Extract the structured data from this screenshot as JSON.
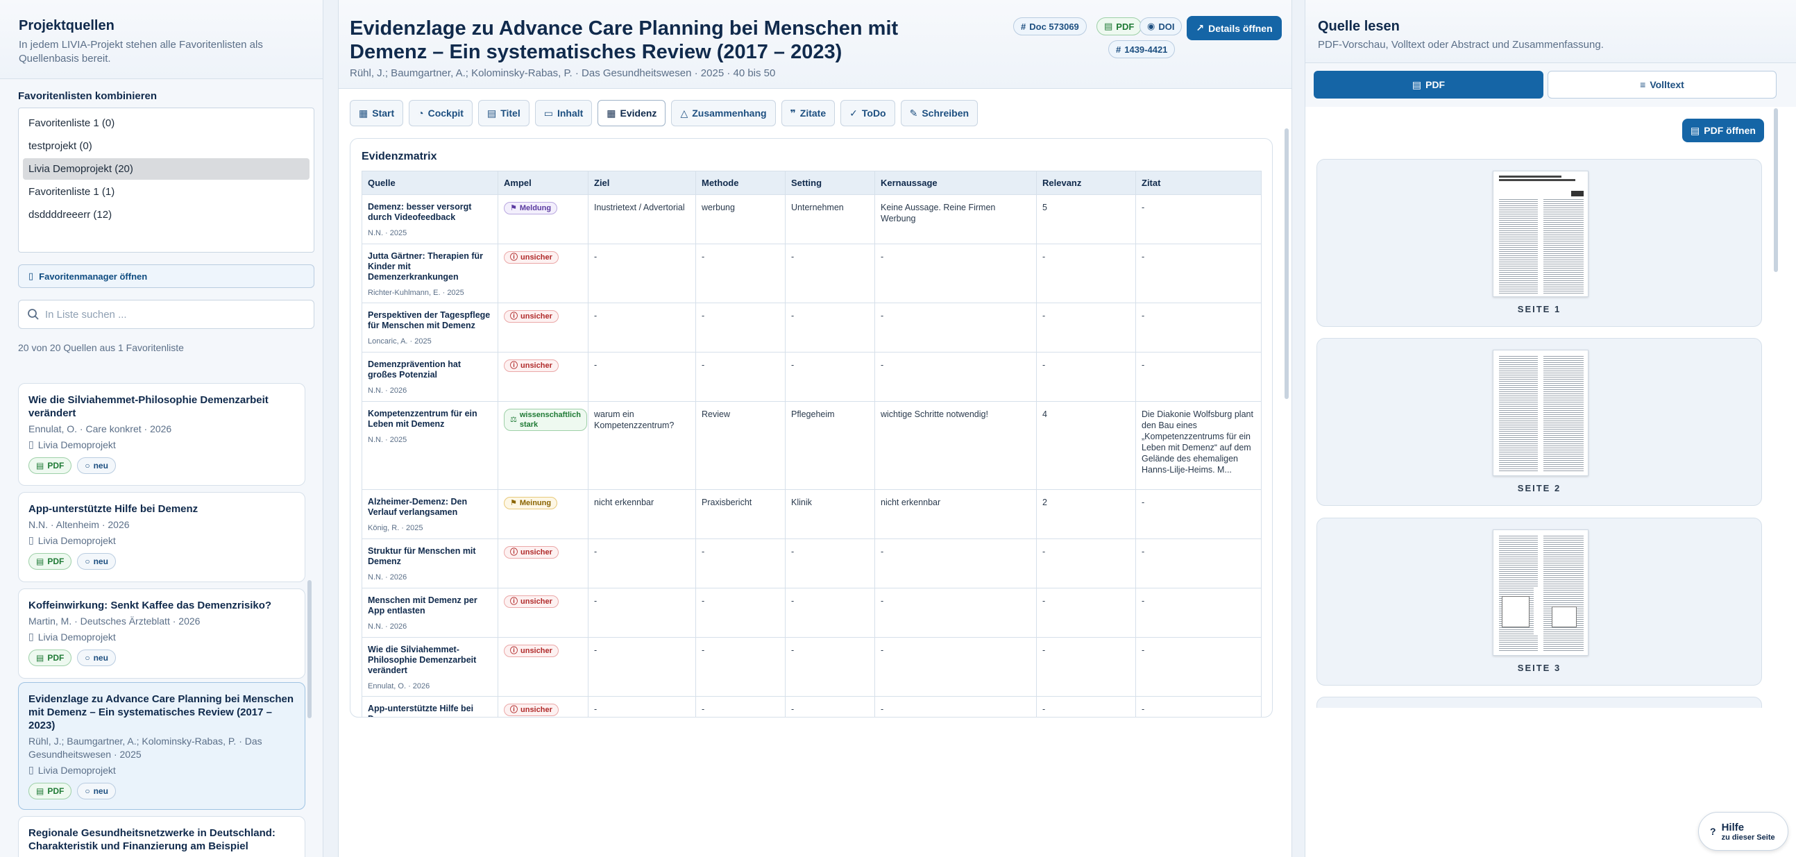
{
  "left": {
    "title": "Projektquellen",
    "subtitle": "In jedem LIVIA-Projekt stehen alle Favoritenlisten als Quellenbasis bereit.",
    "combine_label": "Favoritenlisten kombinieren",
    "lists": [
      "Favoritenliste 1 (0)",
      "testprojekt (0)",
      "Livia Demoprojekt (20)",
      "Favoritenliste 1 (1)",
      "dsddddreeerr (12)"
    ],
    "manager_button": "Favoritenmanager öffnen",
    "search_placeholder": "In Liste suchen ...",
    "count_text": "20 von 20 Quellen aus 1 Favoritenliste",
    "cards": [
      {
        "title": "Wie die Silviahemmet-Philosophie Demenzarbeit verändert",
        "meta": "Ennulat, O. · Care konkret · 2026",
        "project": "Livia Demoprojekt",
        "tag_pdf": "PDF",
        "tag_neu": "neu"
      },
      {
        "title": "App-unterstützte Hilfe bei Demenz",
        "meta": "N.N. · Altenheim · 2026",
        "project": "Livia Demoprojekt",
        "tag_pdf": "PDF",
        "tag_neu": "neu"
      },
      {
        "title": "Koffeinwirkung: Senkt Kaffee das Demenzrisiko?",
        "meta": "Martin, M. · Deutsches Ärzteblatt · 2026",
        "project": "Livia Demoprojekt",
        "tag_pdf": "PDF",
        "tag_neu": "neu"
      },
      {
        "title": "Evidenzlage zu Advance Care Planning bei Menschen mit Demenz – Ein systematisches Review (2017 – 2023)",
        "meta": "Rühl, J.; Baumgartner, A.; Kolominsky-Rabas, P. · Das Gesundheitswesen · 2025",
        "project": "Livia Demoprojekt",
        "tag_pdf": "PDF",
        "tag_neu": "neu"
      },
      {
        "title": "Regionale Gesundheitsnetzwerke in Deutschland: Charakteristik und Finanzierung am Beispiel"
      }
    ]
  },
  "main": {
    "title": "Evidenzlage zu Advance Care Planning bei Menschen mit Demenz – Ein systematisches Review (2017 – 2023)",
    "subline": "Rühl, J.; Baumgartner, A.; Kolominsky-Rabas, P. · Das Gesundheitswesen · 2025 · 40 bis 50",
    "chip_doc": "Doc 573069",
    "chip_pdf": "PDF",
    "chip_doi": "DOI",
    "chip_issn": "1439-4421",
    "details_button": "Details öffnen",
    "tabs": [
      "Start",
      "Cockpit",
      "Titel",
      "Inhalt",
      "Evidenz",
      "Zusammenhang",
      "Zitate",
      "ToDo",
      "Schreiben"
    ],
    "matrix_title": "Evidenzmatrix",
    "columns": [
      "Quelle",
      "Ampel",
      "Ziel",
      "Methode",
      "Setting",
      "Kernaussage",
      "Relevanz",
      "Zitat"
    ],
    "rows": [
      {
        "title": "Demenz: besser versorgt durch Videofeedback",
        "meta": "N.N. · 2025",
        "ampel": "Meldung",
        "ampel_type": "meld",
        "ziel": "Inustrietext / Advertorial",
        "methode": "werbung",
        "setting": "Unternehmen",
        "kern": "Keine Aussage. Reine Firmen Werbung",
        "rel": "5",
        "zitat": "-"
      },
      {
        "title": "Jutta Gärtner: Therapien für Kinder mit Demenzerkrankungen",
        "meta": "Richter-Kuhlmann, E. · 2025",
        "ampel": "unsicher",
        "ampel_type": "uns",
        "ziel": "-",
        "methode": "-",
        "setting": "-",
        "kern": "-",
        "rel": "-",
        "zitat": "-"
      },
      {
        "title": "Perspektiven der Tagespflege für Menschen mit Demenz",
        "meta": "Loncaric, A. · 2025",
        "ampel": "unsicher",
        "ampel_type": "uns",
        "ziel": "-",
        "methode": "-",
        "setting": "-",
        "kern": "-",
        "rel": "-",
        "zitat": "-"
      },
      {
        "title": "Demenzprävention hat großes Potenzial",
        "meta": "N.N. · 2026",
        "ampel": "unsicher",
        "ampel_type": "uns",
        "ziel": "-",
        "methode": "-",
        "setting": "-",
        "kern": "-",
        "rel": "-",
        "zitat": "-"
      },
      {
        "title": "Kompetenzzentrum für ein Leben mit Demenz",
        "meta": "N.N. · 2025",
        "ampel": "wissenschaftlich stark",
        "ampel_type": "wiss",
        "ziel": "warum ein Kompetenzzentrum?",
        "methode": "Review",
        "setting": "Pflegeheim",
        "kern": "wichtige Schritte notwendig!",
        "rel": "4",
        "zitat": "Die Diakonie Wolfsburg plant den Bau eines „Kompetenzzentrums für ein Leben mit Demenz“ auf dem Gelände des ehemaligen Hanns-Lilje-Heims. M..."
      },
      {
        "title": "Alzheimer-Demenz: Den Verlauf verlangsamen",
        "meta": "König, R. · 2025",
        "ampel": "Meinung",
        "ampel_type": "mein",
        "ziel": "nicht erkennbar",
        "methode": "Praxisbericht",
        "setting": "Klinik",
        "kern": "nicht erkennbar",
        "rel": "2",
        "zitat": "-"
      },
      {
        "title": "Struktur für Menschen mit Demenz",
        "meta": "N.N. · 2026",
        "ampel": "unsicher",
        "ampel_type": "uns",
        "ziel": "-",
        "methode": "-",
        "setting": "-",
        "kern": "-",
        "rel": "-",
        "zitat": "-"
      },
      {
        "title": "Menschen mit Demenz per App entlasten",
        "meta": "N.N. · 2026",
        "ampel": "unsicher",
        "ampel_type": "uns",
        "ziel": "-",
        "methode": "-",
        "setting": "-",
        "kern": "-",
        "rel": "-",
        "zitat": "-"
      },
      {
        "title": "Wie die Silviahemmet-Philosophie Demenzarbeit verändert",
        "meta": "Ennulat, O. · 2026",
        "ampel": "unsicher",
        "ampel_type": "uns",
        "ziel": "-",
        "methode": "-",
        "setting": "-",
        "kern": "-",
        "rel": "-",
        "zitat": "-"
      },
      {
        "title": "App-unterstützte Hilfe bei Demenz",
        "meta": "",
        "ampel": "unsicher",
        "ampel_type": "uns",
        "ziel": "-",
        "methode": "-",
        "setting": "-",
        "kern": "-",
        "rel": "-",
        "zitat": "-"
      }
    ]
  },
  "right": {
    "title": "Quelle lesen",
    "subtitle": "PDF-Vorschau, Volltext oder Abstract und Zusammenfassung.",
    "toggle_pdf": "PDF",
    "toggle_volltext": "Volltext",
    "open_pdf": "PDF öffnen",
    "pages": [
      "SEITE 1",
      "SEITE 2",
      "SEITE 3"
    ]
  },
  "help": {
    "label": "Hilfe",
    "sub": "zu dieser Seite"
  },
  "colors": {
    "primary": "#1565a6",
    "navy": "#102a4c",
    "accent_green": "#1f7a35",
    "warn_red": "#b02a2a"
  }
}
